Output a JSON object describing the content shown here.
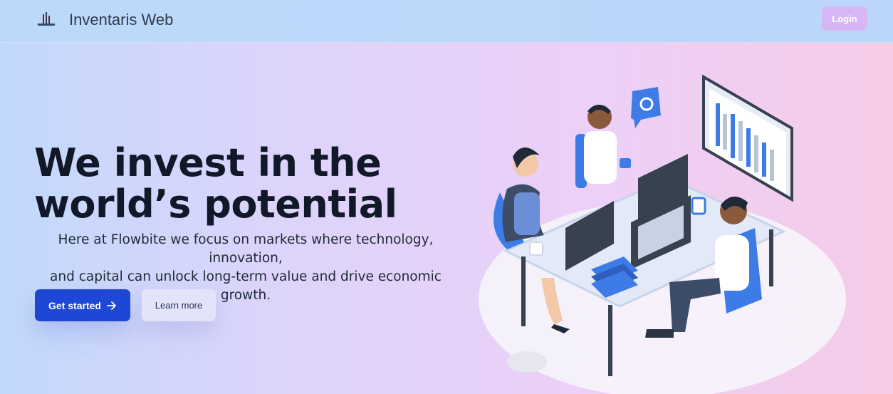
{
  "navbar": {
    "brand": "Inventaris Web",
    "login_label": "Login",
    "logo_icon": "building-logo-icon"
  },
  "hero": {
    "title_line1": "We invest in the",
    "title_line2": "world’s potential",
    "description_line1": "Here at Flowbite we focus on markets where technology, innovation,",
    "description_line2": "and capital can unlock long-term value and drive economic growth.",
    "primary_button": "Get started",
    "secondary_button": "Learn more",
    "arrow_icon": "arrow-right-icon"
  },
  "colors": {
    "primary": "#1e47d6",
    "login": "#d6b7f6",
    "title": "#111827"
  }
}
